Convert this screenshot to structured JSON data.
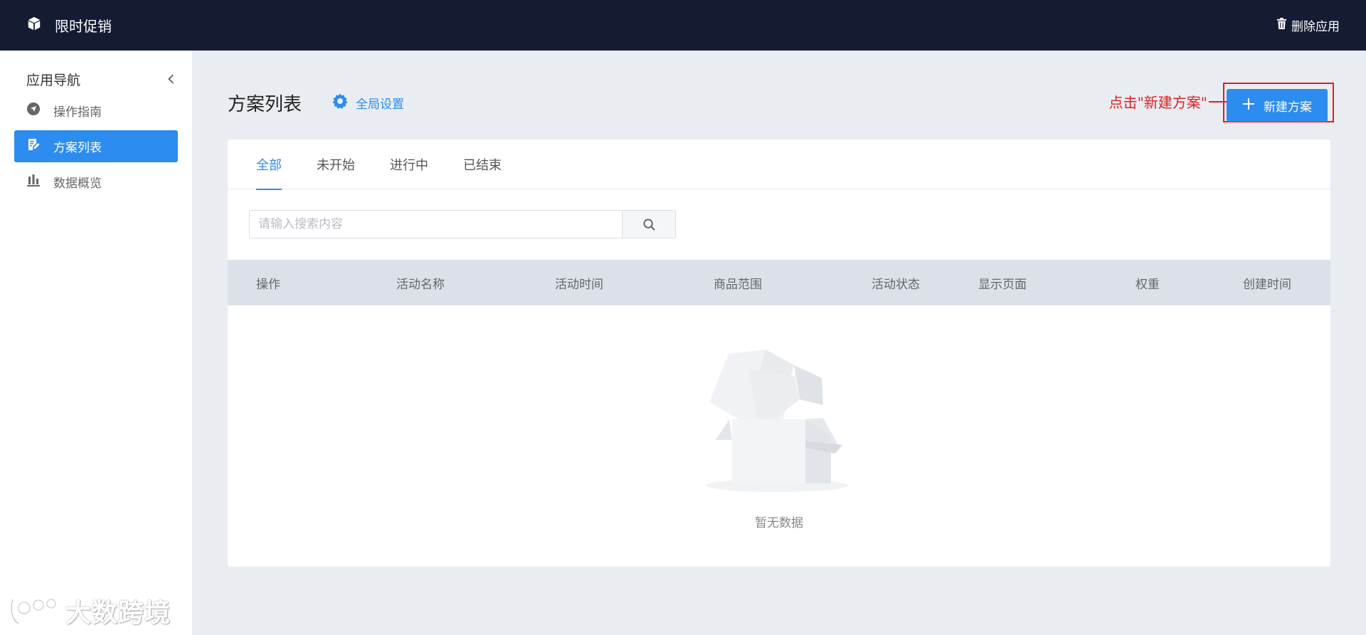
{
  "app": {
    "title": "限时促销",
    "delete_label": "删除应用"
  },
  "sidebar": {
    "title": "应用导航",
    "items": [
      {
        "label": "操作指南",
        "icon": "navigation-icon",
        "active": false
      },
      {
        "label": "方案列表",
        "icon": "edit-list-icon",
        "active": true
      },
      {
        "label": "数据概览",
        "icon": "bar-chart-icon",
        "active": false
      }
    ]
  },
  "main": {
    "title": "方案列表",
    "global_settings_label": "全局设置",
    "new_plan_label": "新建方案",
    "annotation": "点击\"新建方案\""
  },
  "tabs": [
    {
      "label": "全部",
      "active": true
    },
    {
      "label": "未开始",
      "active": false
    },
    {
      "label": "进行中",
      "active": false
    },
    {
      "label": "已结束",
      "active": false
    }
  ],
  "search": {
    "placeholder": "请输入搜索内容",
    "value": ""
  },
  "table": {
    "columns": [
      "操作",
      "活动名称",
      "活动时间",
      "商品范围",
      "活动状态",
      "显示页面",
      "权重",
      "创建时间"
    ],
    "rows": [],
    "empty_text": "暂无数据"
  },
  "watermark": {
    "text": "大数跨境"
  },
  "colors": {
    "topbar": "#141c33",
    "accent": "#2d8cf0",
    "annotation": "#e02020",
    "page_bg": "#e9edf2"
  }
}
